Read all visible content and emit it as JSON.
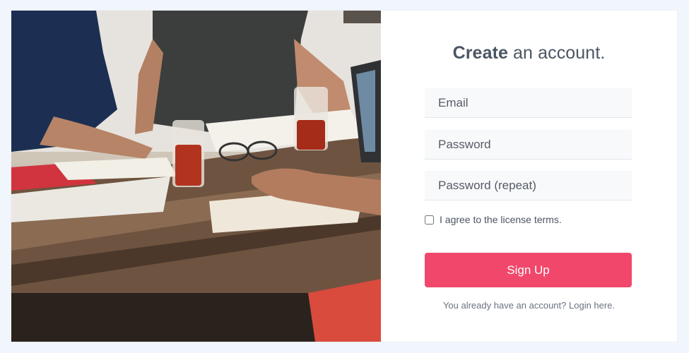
{
  "form": {
    "title_bold": "Create",
    "title_rest": "an account.",
    "email_placeholder": "Email",
    "password_placeholder": "Password",
    "password_repeat_placeholder": "Password (repeat)",
    "agree_label": "I agree to the license terms.",
    "signup_label": "Sign Up",
    "login_prefix": "You already have an account?",
    "login_link": "Login here."
  },
  "colors": {
    "background": "#f1f5fc",
    "accent": "#f1476b",
    "text": "#4b5563"
  },
  "icons": {
    "photo": "people-working-at-table-photo"
  }
}
